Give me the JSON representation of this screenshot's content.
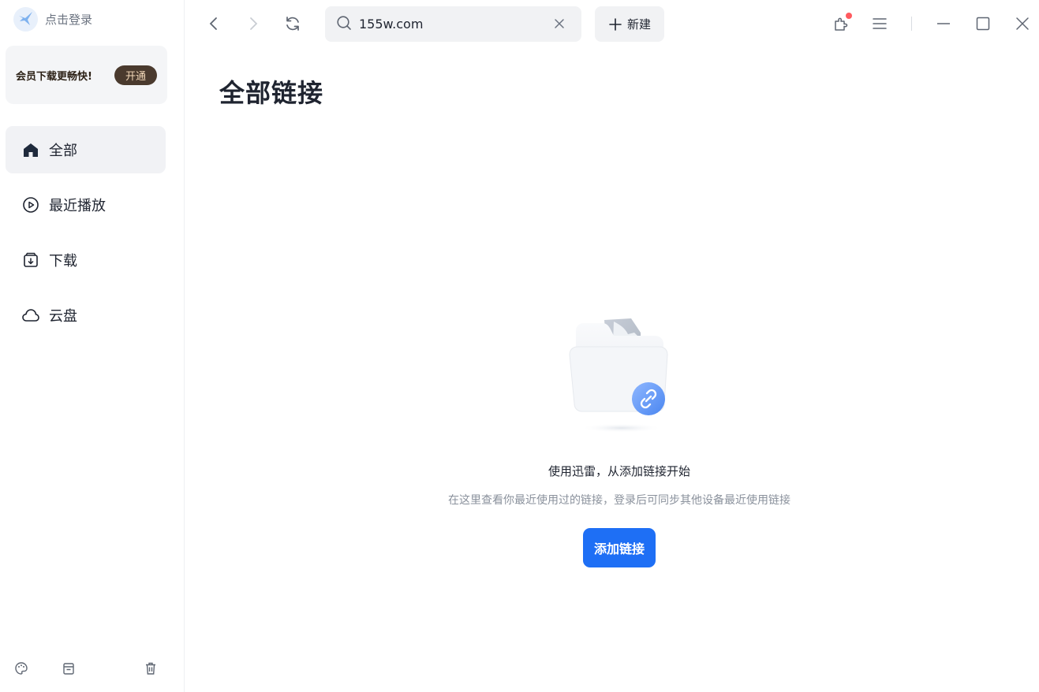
{
  "sidebar": {
    "login_label": "点击登录",
    "vip": {
      "text": "会员下载更畅快!",
      "button": "开通"
    },
    "items": [
      {
        "label": "全部",
        "icon": "home-icon"
      },
      {
        "label": "最近播放",
        "icon": "play-circle-icon"
      },
      {
        "label": "下载",
        "icon": "download-box-icon"
      },
      {
        "label": "云盘",
        "icon": "cloud-icon"
      }
    ]
  },
  "topbar": {
    "search_value": "155w.com",
    "new_label": "新建"
  },
  "main": {
    "title": "全部链接",
    "empty_title": "使用迅雷，从添加链接开始",
    "empty_desc": "在这里查看你最近使用过的链接，登录后可同步其他设备最近使用链接",
    "add_button": "添加链接"
  },
  "colors": {
    "accent": "#1e6ff5",
    "vip_button_bg": "#4a3a2e",
    "vip_button_text": "#f3d8b8",
    "notification_dot": "#ff5a5f"
  }
}
